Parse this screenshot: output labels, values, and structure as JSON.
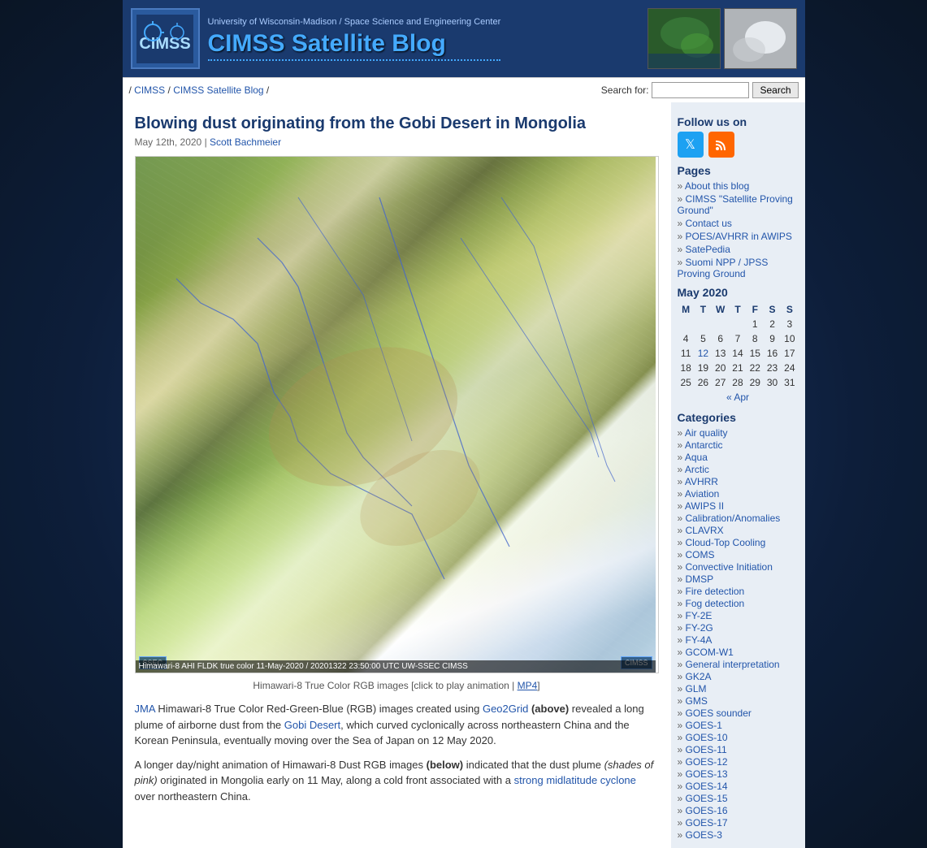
{
  "header": {
    "university": "University of Wisconsin-Madison  /  Space Science and Engineering Center",
    "site_title": "CIMSS Satellite Blog",
    "logo_text": "CIMSS"
  },
  "nav": {
    "breadcrumb": "/ CIMSS / CIMSS Satellite Blog /",
    "cimss_link": "CIMSS",
    "blog_link": "CIMSS Satellite Blog",
    "search_label": "Search for:",
    "search_placeholder": "",
    "search_btn": "Search"
  },
  "post": {
    "title": "Blowing dust originating from the Gobi Desert in Mongolia",
    "date": "May 12th, 2020",
    "author": "Scott Bachmeier",
    "image_caption_text": "Himawari-8 True Color RGB images [click to play animation |",
    "image_caption_link": "MP4",
    "image_bar_text": "Himawari-8 AHI FLDK true color 11-May-2020 / 20201322 23:50:00 UTC UW-SSEC CIMSS",
    "ssec_badge": "SSEC",
    "cimss_badge": "CIMSS",
    "body_p1_prefix": "JMA",
    "body_p1_text": " Himawari-8 True Color Red-Green-Blue (RGB) images created using ",
    "body_p1_link1": "Geo2Grid",
    "body_p1_bold": " (above)",
    "body_p1_text2": " revealed a long plume of airborne dust from the ",
    "body_p1_link2": "Gobi Desert",
    "body_p1_text3": ", which curved cyclonically across northeastern China and the Korean Peninsula, eventually moving over the Sea of Japan on 12 May 2020.",
    "body_p2_text1": "A longer day/night animation of Himawari-8 Dust RGB images ",
    "body_p2_bold": "(below)",
    "body_p2_text2": " indicated that the dust plume ",
    "body_p2_italic": "(shades of pink)",
    "body_p2_text3": " originated in Mongolia early on 11 May, along a cold front associated with a ",
    "body_p2_link": "strong midlatitude cyclone",
    "body_p2_text4": " over northeastern China."
  },
  "sidebar": {
    "follow_title": "Follow us on",
    "pages_title": "Pages",
    "pages": [
      {
        "label": "About this blog",
        "href": "#"
      },
      {
        "label": "CIMSS \"Satellite Proving Ground\"",
        "href": "#"
      },
      {
        "label": "Contact us",
        "href": "#"
      },
      {
        "label": "POES/AVHRR in AWIPS",
        "href": "#"
      },
      {
        "label": "SatePedia",
        "href": "#"
      },
      {
        "label": "Suomi NPP / JPSS Proving Ground",
        "href": "#"
      }
    ],
    "calendar_title": "May 2020",
    "calendar_headers": [
      "M",
      "T",
      "W",
      "T",
      "F",
      "S",
      "S"
    ],
    "calendar_rows": [
      [
        "",
        "",
        "",
        "",
        "1",
        "2",
        "3"
      ],
      [
        "4",
        "5",
        "6",
        "7",
        "8",
        "9",
        "10"
      ],
      [
        "11",
        "12",
        "13",
        "14",
        "15",
        "16",
        "17"
      ],
      [
        "18",
        "19",
        "20",
        "21",
        "22",
        "23",
        "24"
      ],
      [
        "25",
        "26",
        "27",
        "28",
        "29",
        "30",
        "31"
      ]
    ],
    "calendar_links": [
      "12"
    ],
    "cal_nav": "« Apr",
    "categories_title": "Categories",
    "categories": [
      "Air quality",
      "Antarctic",
      "Aqua",
      "Arctic",
      "AVHRR",
      "Aviation",
      "AWIPS II",
      "Calibration/Anomalies",
      "CLAVRX",
      "Cloud-Top Cooling",
      "COMS",
      "Convective Initiation",
      "DMSP",
      "Fire detection",
      "Fog detection",
      "FY-2E",
      "FY-2G",
      "FY-4A",
      "GCOM-W1",
      "General interpretation",
      "GK2A",
      "GLM",
      "GMS",
      "GOES sounder",
      "GOES-1",
      "GOES-10",
      "GOES-11",
      "GOES-12",
      "GOES-13",
      "GOES-14",
      "GOES-15",
      "GOES-16",
      "GOES-17",
      "GOES-3"
    ]
  }
}
